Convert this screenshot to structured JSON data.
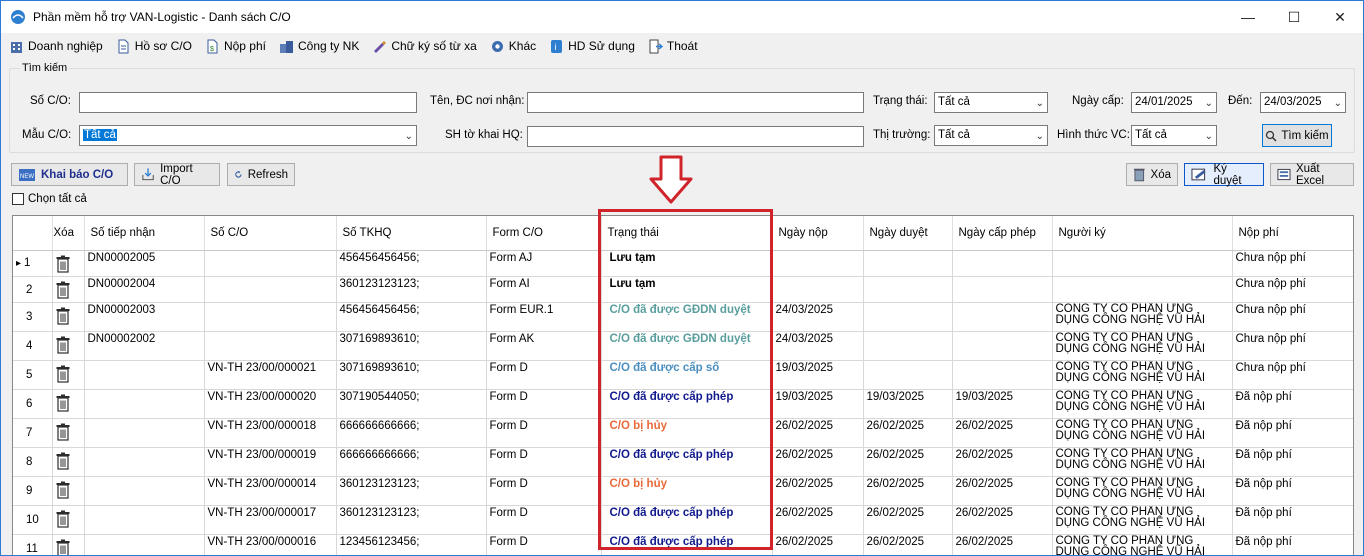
{
  "window": {
    "title": "Phần mềm hỗ trợ VAN-Logistic - Danh sách C/O",
    "min": "—",
    "max": "☐",
    "close": "✕"
  },
  "menu": [
    {
      "label": "Doanh nghiệp",
      "icon": "building-icon"
    },
    {
      "label": "Hồ sơ C/O",
      "icon": "document-icon"
    },
    {
      "label": "Nộp phí",
      "icon": "fee-document-icon"
    },
    {
      "label": "Công ty NK",
      "icon": "company-icon"
    },
    {
      "label": "Chữ ký số từ xa",
      "icon": "signature-icon"
    },
    {
      "label": "Khác",
      "icon": "gear-icon"
    },
    {
      "label": "HD Sử dụng",
      "icon": "help-icon"
    },
    {
      "label": "Thoát",
      "icon": "exit-icon"
    }
  ],
  "search": {
    "legend": "Tìm kiếm",
    "so_co_label": "Số C/O:",
    "so_co_value": "",
    "ten_dc_label": "Tên, ĐC nơi nhận:",
    "ten_dc_value": "",
    "trang_thai_label": "Trạng thái:",
    "trang_thai_value": "Tất cả",
    "ngay_cap_label": "Ngày cấp:",
    "ngay_cap_value": "24/01/2025",
    "den_label": "Đến:",
    "den_value": "24/03/2025",
    "mau_co_label": "Mẫu C/O:",
    "mau_co_value": "Tất cả",
    "sh_to_khai_label": "SH tờ khai HQ:",
    "sh_to_khai_value": "",
    "thi_truong_label": "Thị trường:",
    "thi_truong_value": "Tất cả",
    "hinh_thuc_label": "Hình thức VC:",
    "hinh_thuc_value": "Tất cả",
    "search_button": "Tìm kiếm"
  },
  "toolbar": {
    "khai_bao": "Khai báo C/O",
    "import": "Import C/O",
    "refresh": "Refresh",
    "xoa": "Xóa",
    "ky_duyet": "Ký duyệt",
    "xuat_excel": "Xuất Excel",
    "chon_tat_ca": "Chọn tất cả"
  },
  "grid": {
    "headers": [
      "",
      "Xóa",
      "Số tiếp nhận",
      "Số C/O",
      "Số TKHQ",
      "Form C/O",
      "Trạng thái",
      "Ngày nộp",
      "Ngày duyệt",
      "Ngày cấp phép",
      "Người ký",
      "Nộp phí"
    ],
    "rows": [
      {
        "idx": "1",
        "so_tiep_nhan": "DN00002005",
        "so_co": "",
        "so_tkhq": "456456456456;",
        "form": "Form AJ",
        "status": "Lưu tạm",
        "status_class": "st-draft",
        "ngay_nop": "",
        "ngay_duyet": "",
        "ngay_cap": "",
        "nguoi_ky": "",
        "nop_phi": "Chưa nộp phí",
        "current": true
      },
      {
        "idx": "2",
        "so_tiep_nhan": "DN00002004",
        "so_co": "",
        "so_tkhq": "360123123123;",
        "form": "Form AI",
        "status": "Lưu tạm",
        "status_class": "st-draft",
        "ngay_nop": "",
        "ngay_duyet": "",
        "ngay_cap": "",
        "nguoi_ky": "",
        "nop_phi": "Chưa nộp phí"
      },
      {
        "idx": "3",
        "so_tiep_nhan": "DN00002003",
        "so_co": "",
        "so_tkhq": "456456456456;",
        "form": "Form EUR.1",
        "status": "C/O đã được GĐDN duyệt",
        "status_class": "st-gddn",
        "ngay_nop": "24/03/2025",
        "ngay_duyet": "",
        "ngay_cap": "",
        "nguoi_ky": "CÔNG TY CỔ PHẦN ỨNG DỤNG CÔNG NGHỆ VŨ HẢI",
        "nop_phi": "Chưa nộp phí"
      },
      {
        "idx": "4",
        "so_tiep_nhan": "DN00002002",
        "so_co": "",
        "so_tkhq": "307169893610;",
        "form": "Form AK",
        "status": "C/O đã được GĐDN duyệt",
        "status_class": "st-gddn",
        "ngay_nop": "24/03/2025",
        "ngay_duyet": "",
        "ngay_cap": "",
        "nguoi_ky": "CÔNG TY CỔ PHẦN ỨNG DỤNG CÔNG NGHỆ VŨ HẢI",
        "nop_phi": "Chưa nộp phí"
      },
      {
        "idx": "5",
        "so_tiep_nhan": "",
        "so_co": "VN-TH 23/00/000021",
        "so_tkhq": "307169893610;",
        "form": "Form D",
        "status": "C/O đã được cấp số",
        "status_class": "st-number",
        "ngay_nop": "19/03/2025",
        "ngay_duyet": "",
        "ngay_cap": "",
        "nguoi_ky": "CÔNG TY CỔ PHẦN ỨNG DỤNG CÔNG NGHỆ VŨ HẢI",
        "nop_phi": "Chưa nộp phí"
      },
      {
        "idx": "6",
        "so_tiep_nhan": "",
        "so_co": "VN-TH 23/00/000020",
        "so_tkhq": "307190544050;",
        "form": "Form D",
        "status": "C/O đã được cấp phép",
        "status_class": "st-permit",
        "ngay_nop": "19/03/2025",
        "ngay_duyet": "19/03/2025",
        "ngay_cap": "19/03/2025",
        "nguoi_ky": "CÔNG TY CỔ PHẦN ỨNG DỤNG CÔNG NGHỆ VŨ HẢI",
        "nop_phi": "Đã nộp phí"
      },
      {
        "idx": "7",
        "so_tiep_nhan": "",
        "so_co": "VN-TH 23/00/000018",
        "so_tkhq": "666666666666;",
        "form": "Form D",
        "status": "C/O bị hủy",
        "status_class": "st-cancel",
        "ngay_nop": "26/02/2025",
        "ngay_duyet": "26/02/2025",
        "ngay_cap": "26/02/2025",
        "nguoi_ky": "CÔNG TY CỔ PHẦN ỨNG DỤNG CÔNG NGHỆ VŨ HẢI",
        "nop_phi": "Đã nộp phí"
      },
      {
        "idx": "8",
        "so_tiep_nhan": "",
        "so_co": "VN-TH 23/00/000019",
        "so_tkhq": "666666666666;",
        "form": "Form D",
        "status": "C/O đã được cấp phép",
        "status_class": "st-permit",
        "ngay_nop": "26/02/2025",
        "ngay_duyet": "26/02/2025",
        "ngay_cap": "26/02/2025",
        "nguoi_ky": "CÔNG TY CỔ PHẦN ỨNG DỤNG CÔNG NGHỆ VŨ HẢI",
        "nop_phi": "Đã nộp phí"
      },
      {
        "idx": "9",
        "so_tiep_nhan": "",
        "so_co": "VN-TH 23/00/000014",
        "so_tkhq": "360123123123;",
        "form": "Form D",
        "status": "C/O bị hủy",
        "status_class": "st-cancel",
        "ngay_nop": "26/02/2025",
        "ngay_duyet": "26/02/2025",
        "ngay_cap": "26/02/2025",
        "nguoi_ky": "CÔNG TY CỔ PHẦN ỨNG DỤNG CÔNG NGHỆ VŨ HẢI",
        "nop_phi": "Đã nộp phí"
      },
      {
        "idx": "10",
        "so_tiep_nhan": "",
        "so_co": "VN-TH 23/00/000017",
        "so_tkhq": "360123123123;",
        "form": "Form D",
        "status": "C/O đã được cấp phép",
        "status_class": "st-permit",
        "ngay_nop": "26/02/2025",
        "ngay_duyet": "26/02/2025",
        "ngay_cap": "26/02/2025",
        "nguoi_ky": "CÔNG TY CỔ PHẦN ỨNG DỤNG CÔNG NGHỆ VŨ HẢI",
        "nop_phi": "Đã nộp phí"
      },
      {
        "idx": "11",
        "so_tiep_nhan": "",
        "so_co": "VN-TH 23/00/000016",
        "so_tkhq": "123456123456;",
        "form": "Form D",
        "status": "C/O đã được cấp phép",
        "status_class": "st-permit",
        "ngay_nop": "26/02/2025",
        "ngay_duyet": "26/02/2025",
        "ngay_cap": "26/02/2025",
        "nguoi_ky": "CÔNG TY CỔ PHẦN ỨNG DỤNG CÔNG NGHỆ VŨ HẢI",
        "nop_phi": "Đã nộp phí"
      }
    ]
  },
  "colors": {
    "highlight": "#d0232a",
    "permit": "#101a8c",
    "cancel": "#e86a3a",
    "gddn": "#5a9e9e",
    "number": "#4a8fc0"
  }
}
